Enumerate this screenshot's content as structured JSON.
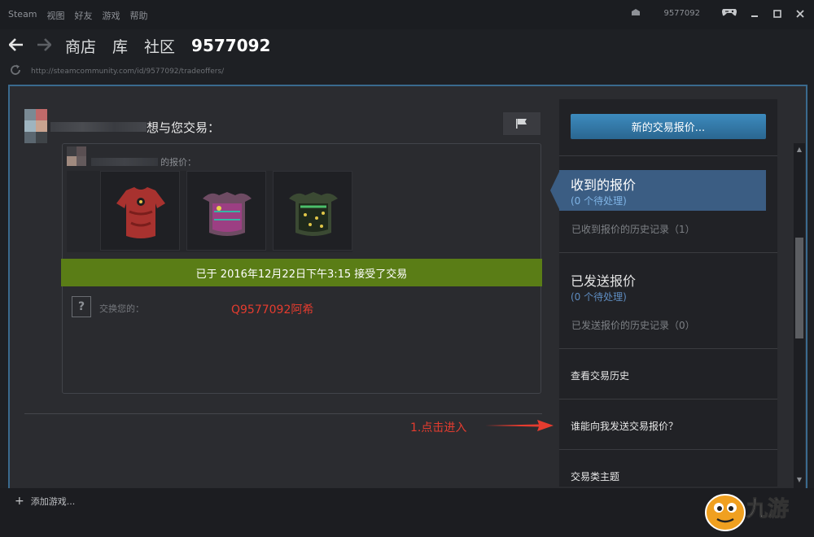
{
  "titlebar": {
    "menu": [
      "Steam",
      "视图",
      "好友",
      "游戏",
      "帮助"
    ],
    "account": "9577092"
  },
  "nav": {
    "links": [
      "商店",
      "库",
      "社区"
    ],
    "username": "9577092"
  },
  "url": "http://steamcommunity.com/id/9577092/tradeoffers/",
  "trade": {
    "title": "想与您交易：",
    "offer_label": "的报价：",
    "accepted_text": "已于 2016年12月22日下午3:15 接受了交易",
    "question_mark": "?",
    "exchange_label": "交换您的：",
    "annotation": "Q9577092阿希"
  },
  "annotation_step": "1.点击进入",
  "sidebar": {
    "new_offer_button": "新的交易报价...",
    "received_title": "收到的报价",
    "received_sub": "(0 个待处理)",
    "received_history": "已收到报价的历史记录（1）",
    "sent_title": "已发送报价",
    "sent_sub": "(0 个待处理)",
    "sent_history": "已发送报价的历史记录（0）",
    "trade_history": "查看交易历史",
    "who_can_send": "谁能向我发送交易报价？",
    "trade_topics": "交易类主题"
  },
  "footer": {
    "add_game": "添加游戏..."
  },
  "colors": {
    "accent_green": "#5a7d16",
    "accent_blue": "#3b5d83",
    "annotation_red": "#e53c2f"
  }
}
